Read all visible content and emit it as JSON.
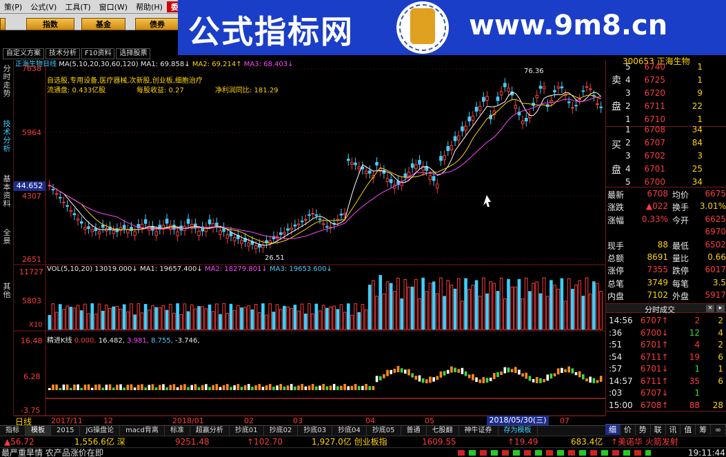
{
  "menu": {
    "items": [
      "策(P)",
      "公式(V)",
      "工具(T)",
      "窗口(W)",
      "帮助(H)",
      "委托"
    ]
  },
  "toolbar": {
    "buttons": [
      "指数",
      "基金",
      "债券"
    ]
  },
  "banner": {
    "title": "公式指标网",
    "url": "www.9m8.cn",
    "seal_small": "www.9m8.cn"
  },
  "subtabs": [
    "自定义方案",
    "技术分析",
    "F10资料",
    "选择股票"
  ],
  "left_strip": [
    "分时走势",
    "技术分析",
    "基本资料",
    "全景",
    "其他"
  ],
  "chart": {
    "stock_title": "正海生物日线",
    "ma_line": "MA(5,10,20,30,60,120)",
    "ma1": "MA1: 69.858↓",
    "ma2": "MA2: 69.214↑",
    "ma3": "MA3: 68.403↓",
    "info1": "自选股,专用设备,医疗器械,次新股,创业板,细胞治疗",
    "info2a": "流通盘: 0.433亿股",
    "info2b": "每股收益: 0.27",
    "info2c": "净利润同比: 181.29",
    "price_ticks": [
      "7638",
      "5964",
      "4307",
      "2651"
    ],
    "current_price_tag": "44.652",
    "high_label": "76.36",
    "low_label": "26.51",
    "vol_title": "VOL(5,10,20)",
    "vol_val": "13019.000↓",
    "vol_ma1": "MA1: 19657.400↓",
    "vol_ma2": "MA2: 18279.801↓",
    "vol_ma3": "MA3: 19653.600↓",
    "vol_ticks": [
      "11727",
      "5803",
      "X10"
    ],
    "ind_title": "精进K线",
    "ind_vals": [
      "0.000,",
      "16.482,",
      "3.981,",
      "8.755,",
      "-3.746,"
    ],
    "ind_ticks": [
      "16.48",
      "6.28",
      "-3.75"
    ],
    "period_label": "日线",
    "date_ticks": [
      "2017/11",
      "12",
      "2018/01",
      "02",
      "03",
      "04",
      "05",
      "07"
    ],
    "cursor_date": "2018/05/30(三)"
  },
  "quote": {
    "header": "300653 正海生物",
    "sell_label": [
      "卖",
      "盘"
    ],
    "buy_label": [
      "买",
      "盘"
    ],
    "sell": [
      {
        "n": "5",
        "p": "6740",
        "v": "1"
      },
      {
        "n": "4",
        "p": "6725",
        "v": "1"
      },
      {
        "n": "3",
        "p": "6720",
        "v": "9"
      },
      {
        "n": "2",
        "p": "6711",
        "v": "22"
      },
      {
        "n": "1",
        "p": "6710",
        "v": "1"
      }
    ],
    "buy": [
      {
        "n": "1",
        "p": "6708",
        "v": "34"
      },
      {
        "n": "2",
        "p": "6707",
        "v": "84"
      },
      {
        "n": "3",
        "p": "6702",
        "v": "3"
      },
      {
        "n": "4",
        "p": "6701",
        "v": "25"
      },
      {
        "n": "5",
        "p": "6700",
        "v": "34"
      }
    ],
    "stats": [
      {
        "l1": "最新",
        "v1": "6708",
        "l2": "均价",
        "v2": "6675"
      },
      {
        "l1": "涨跌",
        "v1": "▲022",
        "l2": "换手",
        "v2": "3.01%"
      },
      {
        "l1": "涨幅",
        "v1": "0.33%",
        "l2": "今开",
        "v2": "6625"
      },
      {
        "l1": "",
        "v1": "",
        "l2": "",
        "v2": "6970"
      },
      {
        "l1": "现手",
        "v1": "88",
        "l2": "最低",
        "v2": "6502"
      },
      {
        "l1": "总额",
        "v1": "8691",
        "l2": "量比",
        "v2": "0.66"
      },
      {
        "l1": "涨停",
        "v1": "7355",
        "l2": "跌停",
        "v2": "6017"
      },
      {
        "l1": "总笔",
        "v1": "3749",
        "l2": "每笔",
        "v2": "3.5"
      },
      {
        "l1": "内盘",
        "v1": "7102",
        "l2": "外盘",
        "v2": "5917"
      }
    ],
    "ticks_title": "分时成交",
    "ticks": [
      {
        "t": "14:56",
        "p": "6707↑",
        "v": "2",
        "n": "2"
      },
      {
        "t": ":36",
        "p": "6700↓",
        "v": "12",
        "n": "4"
      },
      {
        "t": ":51",
        "p": "6701↑",
        "v": "4",
        "n": "2"
      },
      {
        "t": ":54",
        "p": "6711↑",
        "v": "19",
        "n": "6"
      },
      {
        "t": ":57",
        "p": "6701↓",
        "v": "1",
        "n": "1"
      },
      {
        "t": "14:57",
        "p": "6711↑",
        "v": "35",
        "n": "6"
      },
      {
        "t": ":03",
        "p": "6707↓",
        "v": "1",
        "n": ""
      },
      {
        "t": "15:00",
        "p": "6708↑",
        "v": "88",
        "n": "28"
      }
    ],
    "bottom_tabs": [
      "细",
      "价",
      "势",
      "联",
      "讯",
      "值",
      "筹",
      "∞"
    ]
  },
  "bottom_tabs": [
    "指标",
    "模板",
    "2015",
    "JG操盘论",
    "macd背离",
    "标准",
    "超赢分析",
    "抄底01",
    "抄底02",
    "抄底03",
    "抄底04",
    "抄底05",
    "普通",
    "七股翻",
    "神牛证券",
    "存为模板"
  ],
  "status": {
    "s1": "▲56.72",
    "s2": "1,556.6亿 深",
    "s3": "9251.48",
    "s4": "↑102.70",
    "s5": "1,927.0亿 创业板指",
    "s6": "1609.55",
    "s7": "↑19.49",
    "s8": "683.4亿",
    "s9": "↑美诺华 火箭发射"
  },
  "ticker": {
    "text": "最严重旱情 农产品涨价在即",
    "time": "19:11:44"
  }
}
